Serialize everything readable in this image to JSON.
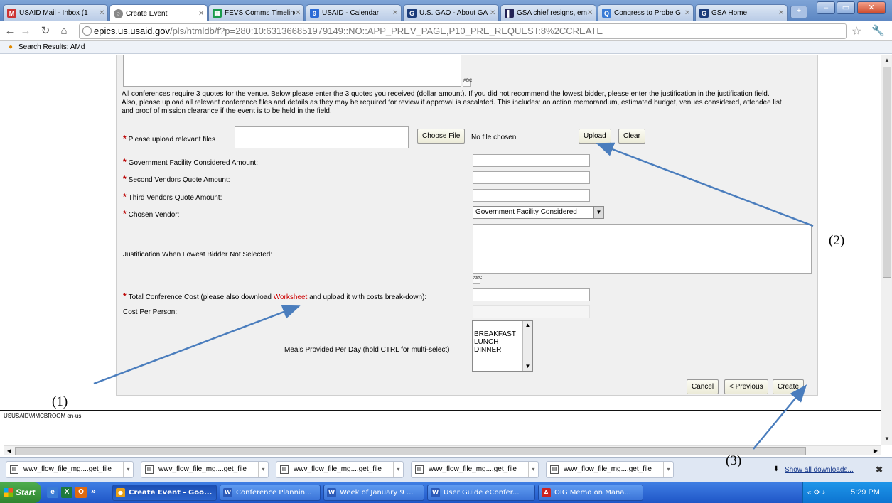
{
  "browser": {
    "tabs": [
      {
        "label": "USAID Mail - Inbox (1",
        "icon": "gmail-icon",
        "color": "#c33"
      },
      {
        "label": "Create Event",
        "icon": "page-icon",
        "color": "#888",
        "active": true
      },
      {
        "label": "FEVS Comms Timeline",
        "icon": "sheets-icon",
        "color": "#1a9b4b"
      },
      {
        "label": "USAID - Calendar",
        "icon": "calendar-icon",
        "color": "#2a6ad6"
      },
      {
        "label": "U.S. GAO - About GA",
        "icon": "gao-icon",
        "color": "#1a3b7a"
      },
      {
        "label": "GSA chief resigns, em",
        "icon": "news-icon",
        "color": "#225"
      },
      {
        "label": "Congress to Probe G",
        "icon": "q-icon",
        "color": "#3a7bd5"
      },
      {
        "label": "GSA Home",
        "icon": "gsa-icon",
        "color": "#1a3b7a"
      }
    ],
    "url_domain": "epics.us.usaid.gov",
    "url_path": "/pls/htmldb/f?p=280:10:631366851979149::NO::APP_PREV_PAGE,P10_PRE_REQUEST:8%2CCREATE",
    "bookmark": "Search Results: AMd"
  },
  "form": {
    "info_text": "All conferences require 3 quotes for the venue. Below please enter the 3 quotes you received (dollar amount). If you did not recommend the lowest bidder, please enter the justification in the justification field. Also, please upload all relevant conference files and details as they may be required for review if approval is escalated. This includes: an action memorandum, estimated budget, venues considered, attendee list and proof of mission clearance if the event is to be held in the field.",
    "required_mark": "*",
    "upload_label": "Please upload relevant files",
    "choose_file": "Choose File",
    "no_file": "No file chosen",
    "upload_btn": "Upload",
    "clear_btn": "Clear",
    "gov_facility_label": "Government Facility Considered Amount:",
    "second_vendor_label": "Second Vendors Quote Amount:",
    "third_vendor_label": "Third Vendors Quote Amount:",
    "chosen_vendor_label": "Chosen Vendor:",
    "chosen_vendor_value": "Government Facility Considered",
    "justification_label": "Justification When Lowest Bidder Not Selected:",
    "total_cost_prefix": "Total Conference Cost (please also download ",
    "worksheet_link": "Worksheet",
    "total_cost_suffix": " and upload it with costs break-down):",
    "cost_per_person_label": "Cost Per Person:",
    "meals_label": "Meals Provided Per Day (hold CTRL for multi-select)",
    "meals_options": [
      "BREAKFAST",
      "LUNCH",
      "DINNER"
    ],
    "cancel_btn": "Cancel",
    "previous_btn": "< Previous",
    "create_btn": "Create",
    "spell_glyph": "ABC"
  },
  "status_line": "USUSAID\\MMCBROOM   en-us",
  "downloads": {
    "items": [
      "wwv_flow_file_mg....get_file",
      "wwv_flow_file_mg....get_file",
      "wwv_flow_file_mg....get_file",
      "wwv_flow_file_mg....get_file",
      "wwv_flow_file_mg....get_file"
    ],
    "show_all": "Show all downloads...",
    "close": "✖"
  },
  "taskbar": {
    "start": "Start",
    "more": "»",
    "tasks": [
      {
        "label": "Create Event - Goo...",
        "icon": "chrome-icon",
        "color": "#e8a016",
        "active": true
      },
      {
        "label": "Conference Plannin...",
        "icon": "word-icon",
        "color": "#2b5ab8"
      },
      {
        "label": "Week of January 9 ...",
        "icon": "word-icon",
        "color": "#2b5ab8"
      },
      {
        "label": "User Guide eConfer...",
        "icon": "word-icon",
        "color": "#2b5ab8"
      },
      {
        "label": "OIG Memo on Mana...",
        "icon": "pdf-icon",
        "color": "#c22"
      }
    ],
    "clock": "5:29 PM",
    "tray_prefix": "«"
  },
  "annotations": {
    "a1": "(1)",
    "a2": "(2)",
    "a3": "(3)"
  },
  "colors": {
    "required": "#b00000",
    "link": "#cc0000",
    "arrow": "#4a7dbd"
  }
}
